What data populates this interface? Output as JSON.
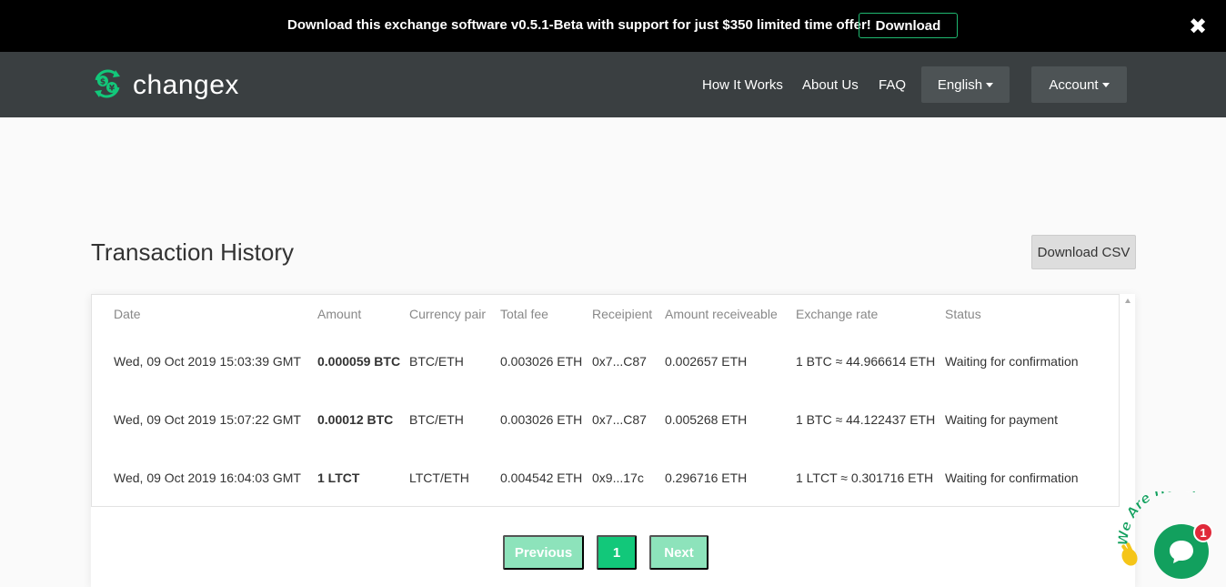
{
  "promo": {
    "text": "Download this exchange software v0.5.1-Beta with support for just $350 limited time offer!",
    "button_label": "Download",
    "close_icon": "close-icon"
  },
  "navbar": {
    "brand": "changex",
    "logo_icon": "currency-exchange-icon",
    "links": [
      "How It Works",
      "About Us",
      "FAQ"
    ],
    "language_label": "English",
    "account_label": "Account"
  },
  "page": {
    "title": "Transaction History",
    "csv_button": "Download CSV"
  },
  "table": {
    "headers": [
      "Date",
      "Amount",
      "Currency pair",
      "Total fee",
      "Receipient",
      "Amount receiveable",
      "Exchange rate",
      "Status"
    ],
    "rows": [
      [
        "Wed, 09 Oct 2019 15:03:39 GMT",
        "0.000059 BTC",
        "BTC/ETH",
        "0.003026 ETH",
        "0x7...C87",
        "0.002657 ETH",
        "1 BTC ≈ 44.966614 ETH",
        "Waiting for confirmation"
      ],
      [
        "Wed, 09 Oct 2019 15:07:22 GMT",
        "0.00012 BTC",
        "BTC/ETH",
        "0.003026 ETH",
        "0x7...C87",
        "0.005268 ETH",
        "1 BTC ≈ 44.122437 ETH",
        "Waiting for payment"
      ],
      [
        "Wed, 09 Oct 2019 16:04:03 GMT",
        "1 LTCT",
        "LTCT/ETH",
        "0.004542 ETH",
        "0x9...17c",
        "0.296716 ETH",
        "1 LTCT ≈ 0.301716 ETH",
        "Waiting for confirmation"
      ]
    ]
  },
  "pagination": {
    "previous": "Previous",
    "current": "1",
    "next": "Next"
  },
  "chat": {
    "badge_text": "We Are Here!",
    "unread_count": "1",
    "icon": "chat-bubble-icon",
    "wave_icon": "waving-hand-icon"
  },
  "colors": {
    "accent": "#12c87a",
    "navbar": "#3a3f41",
    "promo_bg": "#000000",
    "chat": "#12a05e",
    "badge": "#e0293a"
  }
}
